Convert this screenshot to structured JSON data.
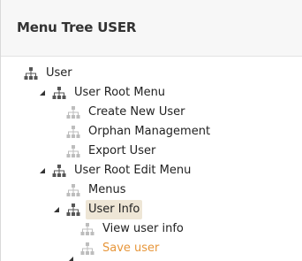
{
  "panel": {
    "title": "Menu Tree USER"
  },
  "tree": {
    "root": {
      "label": "User",
      "icon": "sitemap-icon"
    },
    "user_root_menu": {
      "label": "User Root Menu",
      "icon": "sitemap-icon",
      "expanded": true
    },
    "create_new_user": {
      "label": "Create New User",
      "icon": "sitemap-leaf-icon"
    },
    "orphan_management": {
      "label": "Orphan Management",
      "icon": "sitemap-leaf-icon"
    },
    "export_user": {
      "label": "Export User",
      "icon": "sitemap-leaf-icon"
    },
    "user_root_edit_menu": {
      "label": "User Root Edit Menu",
      "icon": "sitemap-icon",
      "expanded": true
    },
    "menus": {
      "label": "Menus",
      "icon": "sitemap-leaf-icon"
    },
    "user_info": {
      "label": "User Info",
      "icon": "sitemap-icon",
      "expanded": true,
      "selected": true
    },
    "view_user_info": {
      "label": "View user info",
      "icon": "sitemap-leaf-icon"
    },
    "save_user": {
      "label": "Save user",
      "icon": "sitemap-leaf-icon",
      "hover_color": "#e7963a"
    }
  },
  "colors": {
    "selected_bg": "#eee6d6",
    "hover_text": "#e7963a",
    "icon_dark": "#565656",
    "icon_light": "#bdbdbd"
  }
}
